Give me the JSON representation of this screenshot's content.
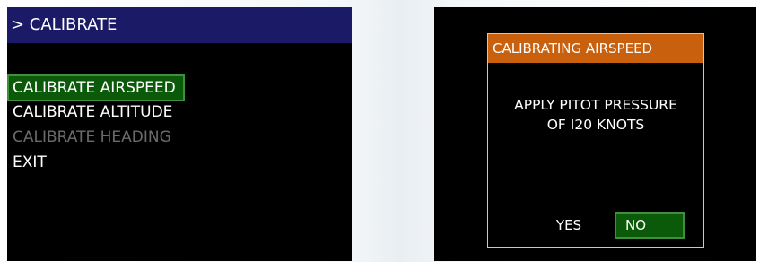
{
  "left_screen": {
    "header": "> CALIBRATE",
    "menu": [
      {
        "label": "CALIBRATE AIRSPEED",
        "state": "selected"
      },
      {
        "label": "CALIBRATE ALTITUDE",
        "state": "enabled"
      },
      {
        "label": "CALIBRATE HEADING",
        "state": "disabled"
      },
      {
        "label": "EXIT",
        "state": "enabled"
      }
    ]
  },
  "right_screen": {
    "dialog": {
      "title": "CALIBRATING AIRSPEED",
      "message": "APPLY PITOT PRESSURE\nOF I20 KNOTS",
      "yes_label": "YES",
      "no_label": "NO",
      "selected_button": "NO"
    }
  },
  "colors": {
    "header_bg": "#1a1a66",
    "dialog_title_bg": "#c8600e",
    "selection_bg": "#0a5a0a",
    "selection_border": "#3f8f3f",
    "disabled_text": "#6b6b6b"
  }
}
